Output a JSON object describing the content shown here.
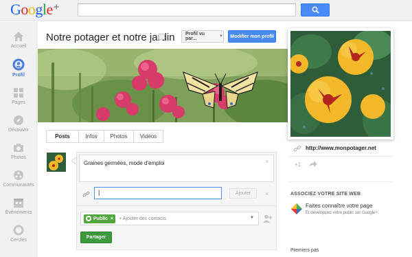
{
  "header": {
    "logo": {
      "g": "G",
      "o1": "o",
      "o2": "o",
      "g2": "g",
      "l": "l",
      "e": "e",
      "plus": "+"
    },
    "search": {
      "value": "",
      "placeholder": ""
    },
    "icons": {
      "search_button": "search-icon"
    }
  },
  "leftnav": {
    "items": [
      {
        "label": "Accueil",
        "icon": "home-icon",
        "active": false
      },
      {
        "label": "Profil",
        "icon": "profile-icon",
        "active": true
      },
      {
        "label": "Pages",
        "icon": "pages-icon",
        "active": false
      },
      {
        "label": "Découvrir",
        "icon": "explore-icon",
        "active": false
      },
      {
        "label": "Photos",
        "icon": "camera-icon",
        "active": false
      },
      {
        "label": "Communautés",
        "icon": "communities-icon",
        "active": false
      },
      {
        "label": "Événements",
        "icon": "calendar-icon",
        "active": false
      },
      {
        "label": "Cercles",
        "icon": "circles-icon",
        "active": false
      }
    ]
  },
  "profile": {
    "title": "Notre potager et notre jardin",
    "view_as_label": "Profil vu par...",
    "edit_label": "Modifier mon profil",
    "website": "http://www.monpotager.net",
    "plus_one": "+1"
  },
  "tabs": [
    {
      "label": "Posts"
    },
    {
      "label": "Infos"
    },
    {
      "label": "Photos"
    },
    {
      "label": "Vidéos"
    }
  ],
  "composer": {
    "text": "Graines germées, mode d'emploi",
    "link_value": "|",
    "add_label": "Ajouter",
    "audience_chip": "Public",
    "chip_close": "×",
    "add_contacts_placeholder": "+ Ajouter des contacts",
    "share_label": "Partager",
    "close": "×"
  },
  "sidebar": {
    "associate_heading": "ASSOCIEZ VOTRE SITE WEB",
    "promo_title": "Faites connaître votre page",
    "promo_sub": "Et développez votre public sur Google+.",
    "first_steps": "Premiers pas"
  },
  "colors": {
    "accent_blue": "#4a8af4",
    "share_green": "#3d9a3f",
    "public_chip": "#53a73f"
  }
}
